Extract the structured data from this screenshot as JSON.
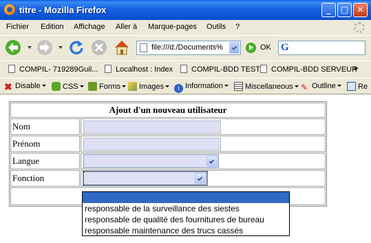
{
  "window": {
    "title": "titre - Mozilla Firefox"
  },
  "menu": [
    "Fichier",
    "Edition",
    "Affichage",
    "Aller à",
    "Marque-pages",
    "Outils",
    "?"
  ],
  "nav": {
    "url": "file:///d:/Documents%",
    "go_label": "OK",
    "search_logo": "G"
  },
  "bookmarks": [
    "COMPIL- 719289Guil...",
    "Localhost : Index",
    "COMPIL-BDD TEST",
    "COMPIL-BDD SERVEUR"
  ],
  "bookmarks_more": "»",
  "devtools": [
    "Disable",
    "CSS",
    "Forms",
    "Images",
    "Information",
    "Miscellaneous",
    "Outline",
    "Re"
  ],
  "form": {
    "heading": "Ajout d'un nouveau utilisateur",
    "labels": {
      "nom": "Nom",
      "prenom": "Prénom",
      "langue": "Langue",
      "fonction": "Fonction"
    }
  },
  "dropdown": {
    "options": [
      "",
      "responsable de la surveillance des siestes",
      "responsable de qualité des fournitures de bureau",
      "responsable maintenance des trucs cassés"
    ],
    "selected_index": 0
  },
  "colors": {
    "titlebar": "#1b66e0",
    "selection": "#316ac5",
    "input_bg": "#dfdff5"
  }
}
